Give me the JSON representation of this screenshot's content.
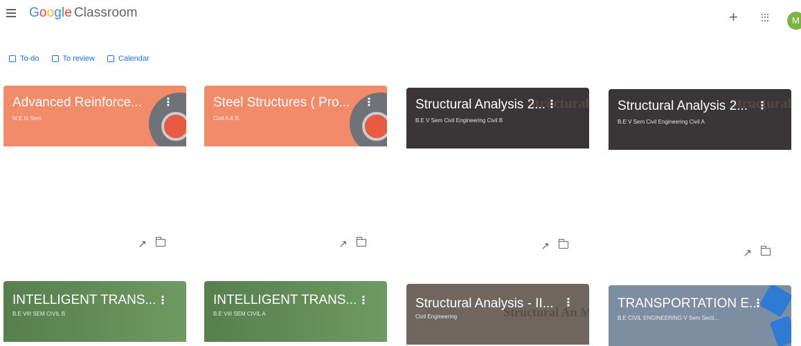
{
  "header": {
    "logo_google": [
      "G",
      "o",
      "o",
      "g",
      "l",
      "e"
    ],
    "logo_product": "Classroom",
    "avatar_initial": "M"
  },
  "subnav": [
    {
      "label": "To-do",
      "icon": "checklist-icon"
    },
    {
      "label": "To review",
      "icon": "review-icon"
    },
    {
      "label": "Calendar",
      "icon": "calendar-icon"
    }
  ],
  "cards": [
    {
      "title": "Advanced Reinforce...",
      "subtitle": "M.E III Sem",
      "theme": "#f28b6a"
    },
    {
      "title": "Steel Structures ( Pro...",
      "subtitle": "Civil A & B",
      "theme": "#f28b6a"
    },
    {
      "title": "Structural Analysis  2...",
      "subtitle": "B.E V Sem Civil Engineering Civil   B",
      "theme": "#3a3537",
      "watermark": "Structural Mohd N"
    },
    {
      "title": "Structural Analysis  2...",
      "subtitle": "B.E V Sem Civil Engineering Civil   A",
      "theme": "#3a3537",
      "watermark": "Structural Mohd N"
    },
    {
      "title": "INTELLIGENT TRANS...",
      "subtitle": "B.E  VIII SEM CIVIL    B",
      "theme": "#5f8a55"
    },
    {
      "title": "INTELLIGENT TRANS...",
      "subtitle": "B.E  VIII SEM CIVIL    A",
      "theme": "#5f8a55"
    },
    {
      "title": "Structural Analysis - II...",
      "subtitle": "Civil Engineering",
      "theme": "#6f6660",
      "watermark": "Structural An Mohd Na"
    },
    {
      "title": "TRANSPORTATION E...",
      "subtitle": "B.E CIVIL ENGINEERING  V Sem Secti...",
      "theme": "#7d8ea3"
    }
  ]
}
